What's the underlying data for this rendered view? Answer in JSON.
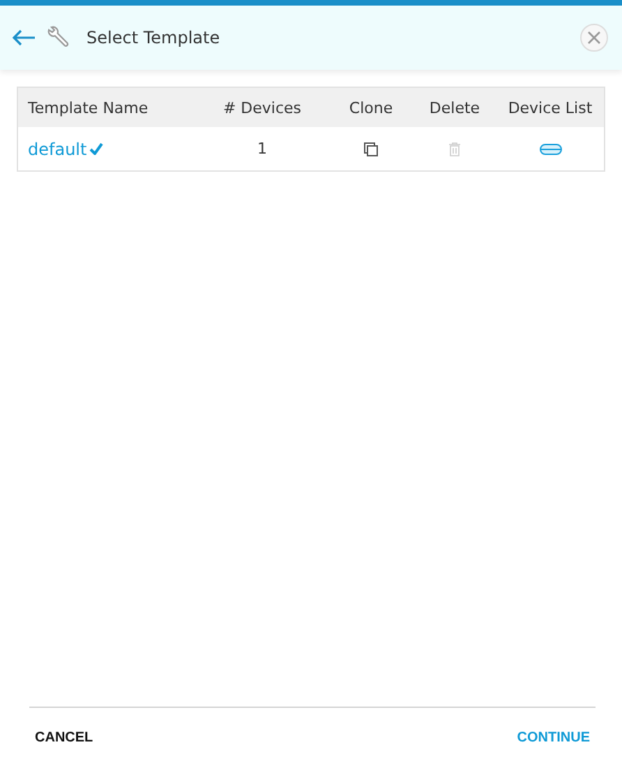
{
  "header": {
    "title": "Select Template"
  },
  "table": {
    "columns": [
      "Template Name",
      "# Devices",
      "Clone",
      "Delete",
      "Device List"
    ],
    "rows": [
      {
        "name": "default",
        "selected": true,
        "devices": "1",
        "delete_disabled": true
      }
    ]
  },
  "footer": {
    "cancel": "CANCEL",
    "continue": "CONTINUE"
  }
}
